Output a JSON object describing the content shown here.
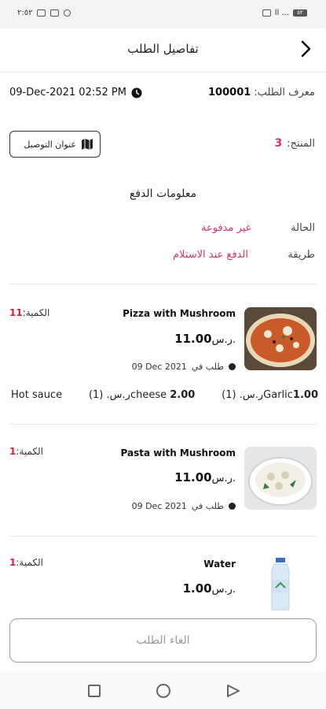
{
  "status_bar": {
    "time": "٢:٥٢",
    "right_text": "ll ...",
    "battery": "٥٢"
  },
  "header": {
    "title": "تفاصيل الطلب"
  },
  "order": {
    "id_label": "معرف الطلب:",
    "id_value": "100001",
    "datetime": "09-Dec-2021 02:52 PM",
    "products_label": "المنتج:",
    "products_count": "3",
    "address_button": "عنوان التوصيل"
  },
  "payment": {
    "title": "معلومات الدفع",
    "status_label": "الحالة",
    "status_value": "غير مدفوعة",
    "method_label": "طريقة",
    "method_value": "الدفع عند الاستلام"
  },
  "items": [
    {
      "name": "Pizza with Mushroom",
      "price": "11.00",
      "currency": "ر.س.",
      "qty_label": "الكمية:",
      "qty": "11",
      "ordered_prefix": "طلب في",
      "ordered_date": "09 Dec 2021",
      "addons": [
        {
          "name": "Garlic",
          "price": "1.00",
          "currency": "ر.س.",
          "count": "(1)"
        },
        {
          "name": "cheese",
          "price": "2.00",
          "currency": "ر.س.",
          "count": "(1)"
        },
        {
          "name": "Hot sauce",
          "price": "",
          "currency": "",
          "count": ""
        }
      ]
    },
    {
      "name": "Pasta with Mushroom",
      "price": "11.00",
      "currency": "ر.س.",
      "qty_label": "الكمية:",
      "qty": "1",
      "ordered_prefix": "طلب في",
      "ordered_date": "09 Dec 2021"
    },
    {
      "name": "Water",
      "price": "1.00",
      "currency": "ر.س.",
      "qty_label": "الكمية:",
      "qty": "1"
    }
  ],
  "cancel_button": "الغاء الطلب",
  "colors": {
    "accent_pink": "#d8336a",
    "qty_red": "#e0193f"
  }
}
